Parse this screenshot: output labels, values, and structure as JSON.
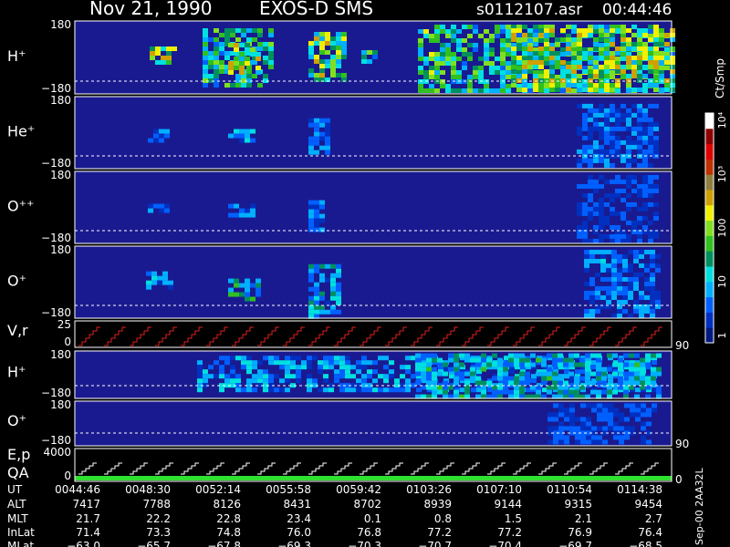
{
  "header": {
    "date": "Nov 21, 1990",
    "instrument": "EXOS-D SMS",
    "file": "s0112107.asr",
    "time": "00:44:46"
  },
  "colorbar": {
    "unit": "Ct/Smp",
    "ticks": [
      "1",
      "10",
      "100",
      "10³",
      "10⁴"
    ],
    "colors": [
      "#001a80",
      "#0030c0",
      "#0060ff",
      "#00b0ff",
      "#00e0e0",
      "#009060",
      "#30c020",
      "#80e020",
      "#f0f000",
      "#d0a000",
      "#908040",
      "#c03000",
      "#e00000",
      "#900000",
      "#ffffff"
    ]
  },
  "panels": [
    {
      "id": "h_plus_pitch",
      "label": "H⁺",
      "ytop": "180",
      "ybottom": "−180"
    },
    {
      "id": "he_plus_pitch",
      "label": "He⁺",
      "ytop": "180",
      "ybottom": "−180"
    },
    {
      "id": "o_pp_pitch",
      "label": "O⁺⁺",
      "ytop": "180",
      "ybottom": "−180"
    },
    {
      "id": "o_plus_pitch",
      "label": "O⁺",
      "ytop": "180",
      "ybottom": "−180"
    },
    {
      "id": "vr",
      "label": "V,r",
      "ytop": "25",
      "ybottom": "0",
      "right_tick": "90"
    },
    {
      "id": "h_plus_2",
      "label": "H⁺",
      "ytop": "180",
      "ybottom": "−180"
    },
    {
      "id": "o_plus_2",
      "label": "O⁺",
      "ytop": "180",
      "ybottom": "−180",
      "right_tick": "90"
    },
    {
      "id": "ep_qa",
      "label": "E,p",
      "label2": "QA",
      "ytop": "4000",
      "ybottom": "0",
      "right_tick": "0"
    }
  ],
  "footer": {
    "row_labels": [
      "UT",
      "ALT",
      "MLT",
      "InLat",
      "MLat"
    ],
    "columns": [
      [
        "0044:46",
        "7417",
        "21.7",
        "71.4",
        "−63.0"
      ],
      [
        "0048:30",
        "7788",
        "22.2",
        "73.3",
        "−65.7"
      ],
      [
        "0052:14",
        "8126",
        "22.8",
        "74.8",
        "−67.8"
      ],
      [
        "0055:58",
        "8431",
        "23.4",
        "76.0",
        "−69.3"
      ],
      [
        "0059:42",
        "8702",
        "0.1",
        "76.8",
        "−70.3"
      ],
      [
        "0103:26",
        "8939",
        "0.8",
        "77.2",
        "−70.7"
      ],
      [
        "0107:10",
        "9144",
        "1.5",
        "77.2",
        "−70.4"
      ],
      [
        "0110:54",
        "9315",
        "2.1",
        "76.9",
        "−69.7"
      ],
      [
        "0114:38",
        "9454",
        "2.7",
        "76.4",
        "−68.5"
      ]
    ],
    "side_label": "Sep-00  2AA32L"
  },
  "chart_data": {
    "type": "heatmap",
    "title": "Nov 21, 1990   EXOS-D SMS",
    "x_ticks": [
      "0044:46",
      "0048:30",
      "0052:14",
      "0055:58",
      "0059:42",
      "0103:26",
      "0107:10",
      "0110:54",
      "0114:38"
    ],
    "x_range": [
      "0044:46",
      "0114:38"
    ],
    "colorscale_unit": "Ct/Smp",
    "colorscale_range": [
      1,
      10000
    ],
    "colorscale_log": true,
    "series": [
      {
        "name": "H⁺",
        "ylim": [
          -180,
          180
        ]
      },
      {
        "name": "He⁺",
        "ylim": [
          -180,
          180
        ]
      },
      {
        "name": "O⁺⁺",
        "ylim": [
          -180,
          180
        ]
      },
      {
        "name": "O⁺",
        "ylim": [
          -180,
          180
        ]
      },
      {
        "name": "V,r",
        "ylim": [
          0,
          25
        ]
      },
      {
        "name": "H⁺",
        "ylim": [
          -180,
          180
        ]
      },
      {
        "name": "O⁺",
        "ylim": [
          -180,
          180
        ]
      },
      {
        "name": "E,p",
        "ylim": [
          0,
          4000
        ]
      }
    ]
  }
}
